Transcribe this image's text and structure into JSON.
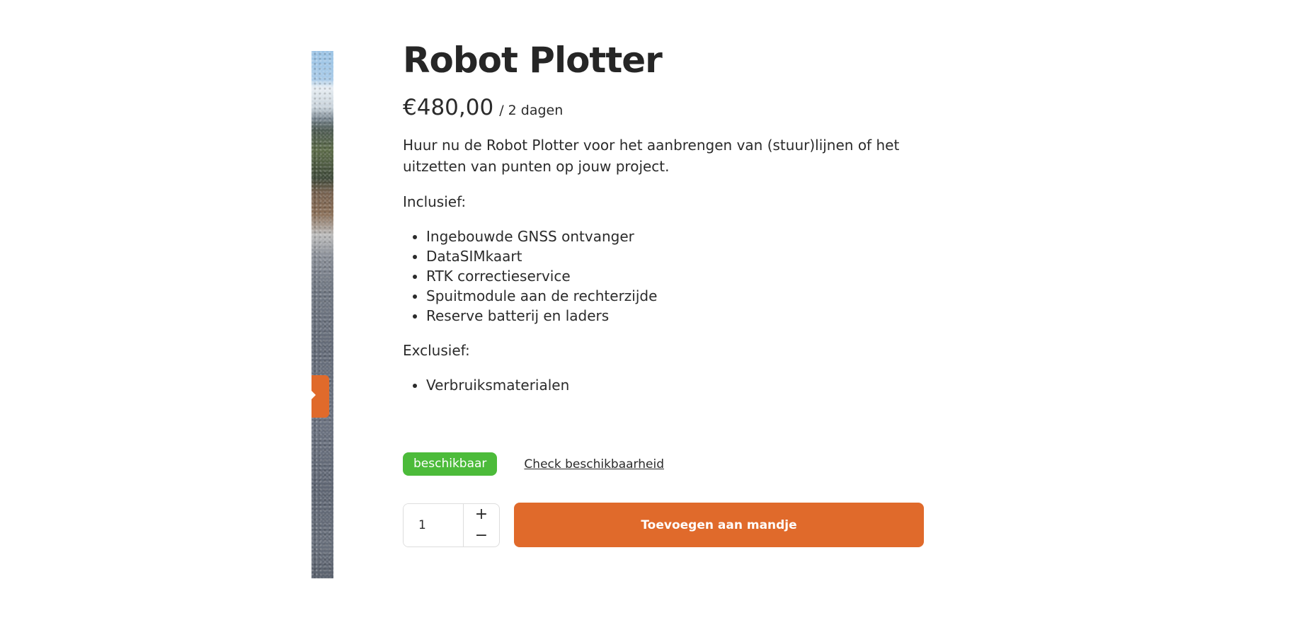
{
  "product": {
    "title": "Robot Plotter",
    "price": "€480,00",
    "price_suffix": "/ 2 dagen",
    "intro": "Huur nu de Robot Plotter voor het aanbrengen van (stuur)lijnen of het uitzetten van punten op jouw project.",
    "included_heading": "Inclusief:",
    "included_items": [
      "Ingebouwde GNSS ontvanger",
      "DataSIMkaart",
      "RTK correctieservice",
      "Spuitmodule aan de rechterzijde",
      "Reserve batterij en laders"
    ],
    "excluded_heading": "Exclusief:",
    "excluded_items": [
      "Verbruiksmaterialen"
    ]
  },
  "availability": {
    "badge": "beschikbaar",
    "check_link": "Check beschikbaarheid"
  },
  "cart": {
    "quantity": "1",
    "plus": "+",
    "minus": "−",
    "add_label": "Toevoegen aan mandje"
  },
  "colors": {
    "accent": "#e06a2b",
    "available": "#4cbb3a",
    "text": "#2b2b2b"
  },
  "icons": {
    "gallery_next": "chevron-right-icon"
  }
}
